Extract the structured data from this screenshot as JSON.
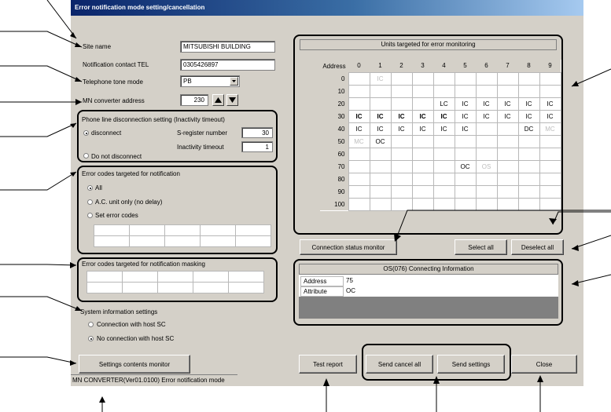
{
  "window": {
    "title": "Error notification mode setting/cancellation"
  },
  "site": {
    "label": "Site name",
    "value": "MITSUBISHI BUILDING"
  },
  "tel": {
    "label": "Notification contact TEL",
    "value": "0305426897"
  },
  "tone": {
    "label": "Telephone tone mode",
    "value": "PB"
  },
  "mn_addr": {
    "label": "MN converter address",
    "value": "230"
  },
  "phone_disc": {
    "title": "Phone line disconnection setting (Inactivity timeout)",
    "opt_disconnect": "disconnect",
    "opt_no": "Do not disconnect",
    "sreg_label": "S-register number",
    "sreg_value": "30",
    "inact_label": "Inactivity timeout",
    "inact_value": "1",
    "selected": "disconnect"
  },
  "err_codes": {
    "title": "Error codes targeted for notification",
    "opt_all": "All",
    "opt_ac": "A.C. unit only (no delay)",
    "opt_set": "Set error codes",
    "selected": "All"
  },
  "masking": {
    "title": "Error codes targeted for notification masking"
  },
  "sysinfo": {
    "title": "System information settings",
    "opt_host": "Connection with host SC",
    "opt_nohost": "No connection with host SC",
    "selected": "No connection with host SC"
  },
  "units": {
    "title": "Units targeted for error monitoring",
    "address_label": "Address",
    "col_headers": [
      "0",
      "1",
      "2",
      "3",
      "4",
      "5",
      "6",
      "7",
      "8",
      "9"
    ],
    "rows": [
      {
        "addr": "0",
        "cells": [
          "",
          {
            "t": "IC",
            "d": 1
          },
          "",
          "",
          "",
          "",
          "",
          "",
          "",
          ""
        ]
      },
      {
        "addr": "10",
        "cells": [
          "",
          "",
          "",
          "",
          "",
          "",
          "",
          "",
          "",
          ""
        ]
      },
      {
        "addr": "20",
        "cells": [
          "",
          "",
          "",
          "",
          "LC",
          "IC",
          "IC",
          "IC",
          "IC",
          "IC"
        ]
      },
      {
        "addr": "30",
        "cells": [
          {
            "t": "IC",
            "b": 1
          },
          {
            "t": "IC",
            "b": 1
          },
          {
            "t": "IC",
            "b": 1
          },
          {
            "t": "IC",
            "b": 1
          },
          {
            "t": "IC",
            "b": 1
          },
          "IC",
          "IC",
          "IC",
          "IC",
          "IC"
        ]
      },
      {
        "addr": "40",
        "cells": [
          "IC",
          "IC",
          "IC",
          "IC",
          "IC",
          "IC",
          "",
          "",
          "DC",
          {
            "t": "MC",
            "d": 1
          }
        ]
      },
      {
        "addr": "50",
        "cells": [
          {
            "t": "MC",
            "d": 1
          },
          "OC",
          "",
          "",
          "",
          "",
          "",
          "",
          "",
          ""
        ]
      },
      {
        "addr": "60",
        "cells": [
          "",
          "",
          "",
          "",
          "",
          "",
          "",
          "",
          "",
          ""
        ]
      },
      {
        "addr": "70",
        "cells": [
          "",
          "",
          "",
          "",
          "",
          "OC",
          {
            "t": "OS",
            "d": 1
          },
          "",
          "",
          ""
        ]
      },
      {
        "addr": "80",
        "cells": [
          "",
          "",
          "",
          "",
          "",
          "",
          "",
          "",
          "",
          ""
        ]
      },
      {
        "addr": "90",
        "cells": [
          "",
          "",
          "",
          "",
          "",
          "",
          "",
          "",
          "",
          ""
        ]
      },
      {
        "addr": "100",
        "cells": [
          "",
          "",
          "",
          "",
          "",
          "",
          "",
          "",
          "",
          ""
        ]
      }
    ]
  },
  "buttons": {
    "conn_status": "Connection status monitor",
    "select_all": "Select all",
    "deselect_all": "Deselect all",
    "settings_monitor": "Settings contents monitor",
    "test_report": "Test report",
    "send_cancel_all": "Send cancel all",
    "send_settings": "Send settings",
    "close": "Close"
  },
  "os_info": {
    "title": "OS(076) Connecting Information",
    "address_label": "Address",
    "address_value": "75",
    "attribute_label": "Attribute",
    "attribute_value": "OC"
  },
  "status_bar": "MN CONVERTER(Ver01.0100) Error notification mode",
  "icons": {
    "spin_up": "triangle-up-icon",
    "spin_down": "triangle-down-icon",
    "dropdown": "chevron-down-icon"
  }
}
